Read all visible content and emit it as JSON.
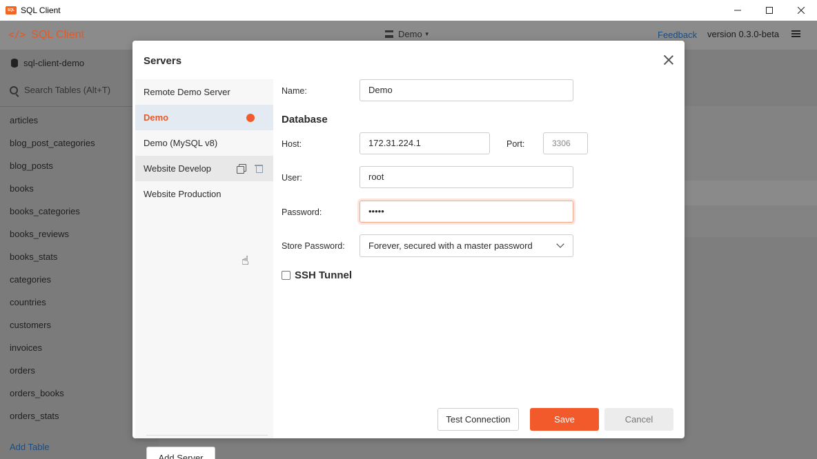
{
  "window": {
    "title": "SQL Client",
    "icon_text": "SQL"
  },
  "header": {
    "brand": "SQL Client",
    "database": "Demo",
    "feedback": "Feedback",
    "version": "version 0.3.0-beta"
  },
  "sidebar": {
    "database": "sql-client-demo",
    "search_placeholder": "Search Tables (Alt+T)",
    "tables": [
      "articles",
      "blog_post_categories",
      "blog_posts",
      "books",
      "books_categories",
      "books_reviews",
      "books_stats",
      "categories",
      "countries",
      "customers",
      "invoices",
      "orders",
      "orders_books",
      "orders_stats"
    ],
    "add_table": "Add Table"
  },
  "modal": {
    "title": "Servers",
    "servers": [
      "Remote Demo Server",
      "Demo",
      "Demo (MySQL v8)",
      "Website Develop",
      "Website Production"
    ],
    "active_server": "Demo",
    "add_server": "Add Server",
    "form": {
      "name_label": "Name:",
      "name_value": "Demo",
      "database_heading": "Database",
      "host_label": "Host:",
      "host_value": "172.31.224.1",
      "port_label": "Port:",
      "port_placeholder": "3306",
      "user_label": "User:",
      "user_value": "root",
      "password_label": "Password:",
      "password_value": "•••••",
      "store_password_label": "Store Password:",
      "store_password_value": "Forever, secured with a master password",
      "ssh_label": "SSH Tunnel"
    },
    "buttons": {
      "test": "Test Connection",
      "save": "Save",
      "cancel": "Cancel"
    }
  },
  "colors": {
    "accent": "#f25a2c",
    "link": "#1b4d80"
  }
}
